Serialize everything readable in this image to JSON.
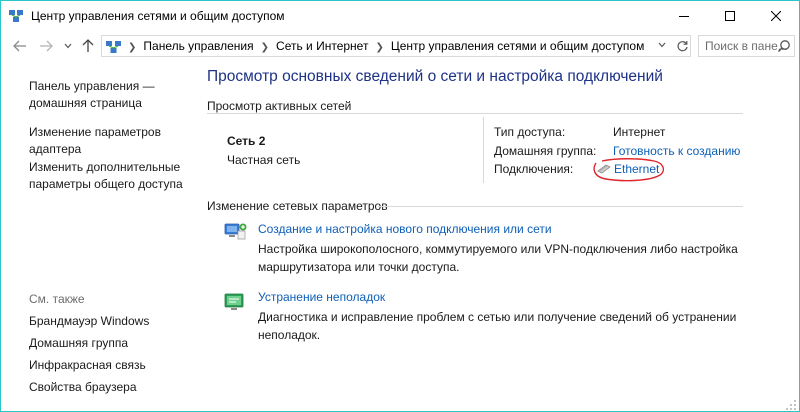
{
  "window": {
    "title": "Центр управления сетями и общим доступом"
  },
  "address": {
    "crumbs": [
      "Панель управления",
      "Сеть и Интернет",
      "Центр управления сетями и общим доступом"
    ],
    "search_placeholder": "Поиск в пане..."
  },
  "sidebar": {
    "home_line1": "Панель управления —",
    "home_line2": "домашняя страница",
    "adapter_line1": "Изменение параметров",
    "adapter_line2": "адаптера",
    "sharing_line1": "Изменить дополнительные",
    "sharing_line2": "параметры общего доступа",
    "see_also": "См. также",
    "see_also_items": [
      "Брандмауэр Windows",
      "Домашняя группа",
      "Инфракрасная связь",
      "Свойства браузера"
    ]
  },
  "main": {
    "title": "Просмотр основных сведений о сети и настройка подключений",
    "active_networks_label": "Просмотр активных сетей",
    "network": {
      "name": "Сеть  2",
      "category": "Частная сеть",
      "access_type_label": "Тип доступа:",
      "access_type_value": "Интернет",
      "homegroup_label": "Домашняя группа:",
      "homegroup_value": "Готовность к созданию",
      "connections_label": "Подключения:",
      "connections_value": "Ethernet"
    },
    "change_settings_label": "Изменение сетевых параметров",
    "tasks": [
      {
        "link": "Создание и настройка нового подключения или сети",
        "desc": "Настройка широкополосного, коммутируемого или VPN-подключения либо настройка маршрутизатора или точки доступа.",
        "icon": "new-connection-icon"
      },
      {
        "link": "Устранение неполадок",
        "desc": "Диагностика и исправление проблем с сетью или получение сведений об устранении неполадок.",
        "icon": "troubleshoot-icon"
      }
    ]
  },
  "colors": {
    "title_blue": "#1e3287",
    "link_blue": "#0d5fb8",
    "annotation_red": "#e0252b",
    "window_border": "#2bc5c9"
  }
}
